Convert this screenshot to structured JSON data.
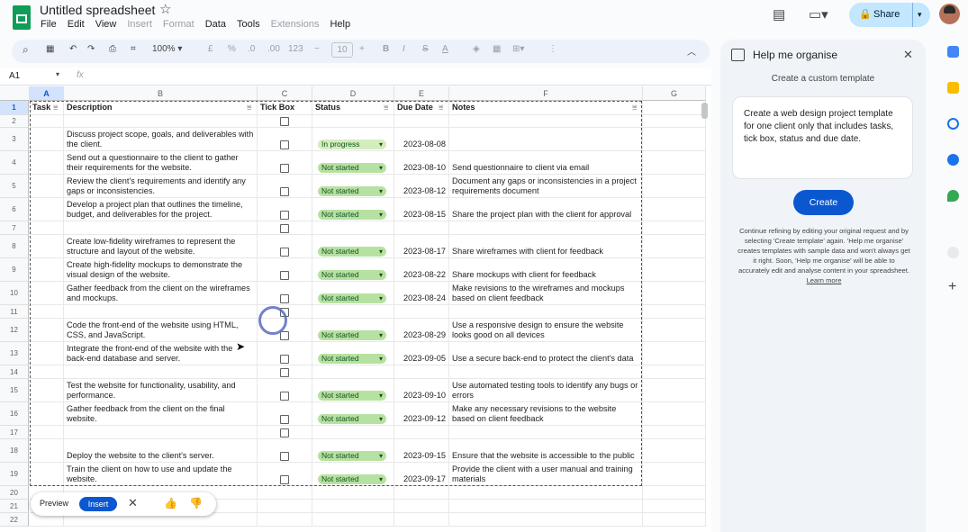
{
  "app": {
    "title": "Untitled spreadsheet",
    "menu": [
      "File",
      "Edit",
      "View",
      "Insert",
      "Format",
      "Data",
      "Tools",
      "Extensions",
      "Help"
    ],
    "menu_disabled": [
      "Insert",
      "Format",
      "Extensions"
    ],
    "share_label": "Share",
    "colors": {
      "accent": "#0b57d0",
      "share_bg": "#c2e7ff",
      "chip": "#b7e1a1",
      "sheets_green": "#0f9d58"
    }
  },
  "toolbar": {
    "zoom": "100%",
    "currency": "£",
    "percent": "%",
    "dec_decrease": ".0",
    "dec_increase": ".00",
    "number_format": "123",
    "font_size": "10"
  },
  "formula_bar": {
    "cell_ref": "A1",
    "fx": "fx"
  },
  "sheet": {
    "columns": [
      "A",
      "B",
      "C",
      "D",
      "E",
      "F",
      "G"
    ],
    "row_numbers": [
      "1",
      "2",
      "3",
      "4",
      "5",
      "6",
      "7",
      "8",
      "9",
      "10",
      "11",
      "12",
      "13",
      "14",
      "15",
      "16",
      "17",
      "18",
      "19",
      "20",
      "21",
      "22"
    ],
    "headers": {
      "task": "Task",
      "description": "Description",
      "tick": "Tick Box",
      "status": "Status",
      "due": "Due Date",
      "notes": "Notes"
    },
    "rows": [
      {
        "desc": "",
        "status": "",
        "due": "",
        "notes": ""
      },
      {
        "desc": "Discuss project scope, goals, and deliverables with the client.",
        "status": "In progress",
        "due": "2023-08-08",
        "notes": ""
      },
      {
        "desc": "Send out a questionnaire to the client to gather their requirements for the website.",
        "status": "Not started",
        "due": "2023-08-10",
        "notes": "Send questionnaire to client via email"
      },
      {
        "desc": "Review the client's requirements and identify any gaps or inconsistencies.",
        "status": "Not started",
        "due": "2023-08-12",
        "notes": "Document any gaps or inconsistencies in a project requirements document"
      },
      {
        "desc": "Develop a project plan that outlines the timeline, budget, and deliverables for the project.",
        "status": "Not started",
        "due": "2023-08-15",
        "notes": "Share the project plan with the client for approval"
      },
      {
        "desc": "",
        "status": "",
        "due": "",
        "notes": ""
      },
      {
        "desc": "Create low-fidelity wireframes to represent the structure and layout of the website.",
        "status": "Not started",
        "due": "2023-08-17",
        "notes": "Share wireframes with client for feedback"
      },
      {
        "desc": "Create high-fidelity mockups to demonstrate the visual design of the website.",
        "status": "Not started",
        "due": "2023-08-22",
        "notes": "Share mockups with client for feedback"
      },
      {
        "desc": "Gather feedback from the client on the wireframes and mockups.",
        "status": "Not started",
        "due": "2023-08-24",
        "notes": "Make revisions to the wireframes and mockups based on client feedback"
      },
      {
        "desc": "",
        "status": "",
        "due": "",
        "notes": ""
      },
      {
        "desc": "Code the front-end of the website using HTML, CSS, and JavaScript.",
        "status": "Not started",
        "due": "2023-08-29",
        "notes": "Use a responsive design to ensure the website looks good on all devices"
      },
      {
        "desc": "Integrate the front-end of the website with the back-end database and server.",
        "status": "Not started",
        "due": "2023-09-05",
        "notes": "Use a secure back-end to protect the client's data"
      },
      {
        "desc": "",
        "status": "",
        "due": "",
        "notes": ""
      },
      {
        "desc": "Test the website for functionality, usability, and performance.",
        "status": "Not started",
        "due": "2023-09-10",
        "notes": "Use automated testing tools to identify any bugs or errors"
      },
      {
        "desc": "Gather feedback from the client on the final website.",
        "status": "Not started",
        "due": "2023-09-12",
        "notes": "Make any necessary revisions to the website based on client feedback"
      },
      {
        "desc": "",
        "status": "",
        "due": "",
        "notes": ""
      },
      {
        "desc": "Deploy the website to the client's server.",
        "status": "Not started",
        "due": "2023-09-15",
        "notes": "Ensure that the website is accessible to the public"
      },
      {
        "desc": "Train the client on how to use and update the website.",
        "status": "Not started",
        "due": "2023-09-17",
        "notes": "Provide the client with a user manual and training materials"
      }
    ]
  },
  "preview_bar": {
    "preview": "Preview",
    "insert": "Insert"
  },
  "panel": {
    "title": "Help me organise",
    "subtitle": "Create a custom template",
    "prompt": "Create a web design project template for one client only that includes tasks, tick box, status and due date.",
    "create": "Create",
    "note": "Continue refining by editing your original request and by selecting 'Create template' again. 'Help me organise' creates templates with sample data and won't always get it right. Soon, 'Help me organise' will be able to accurately edit and analyse content in your spreadsheet.",
    "learn_more": "Learn more"
  }
}
